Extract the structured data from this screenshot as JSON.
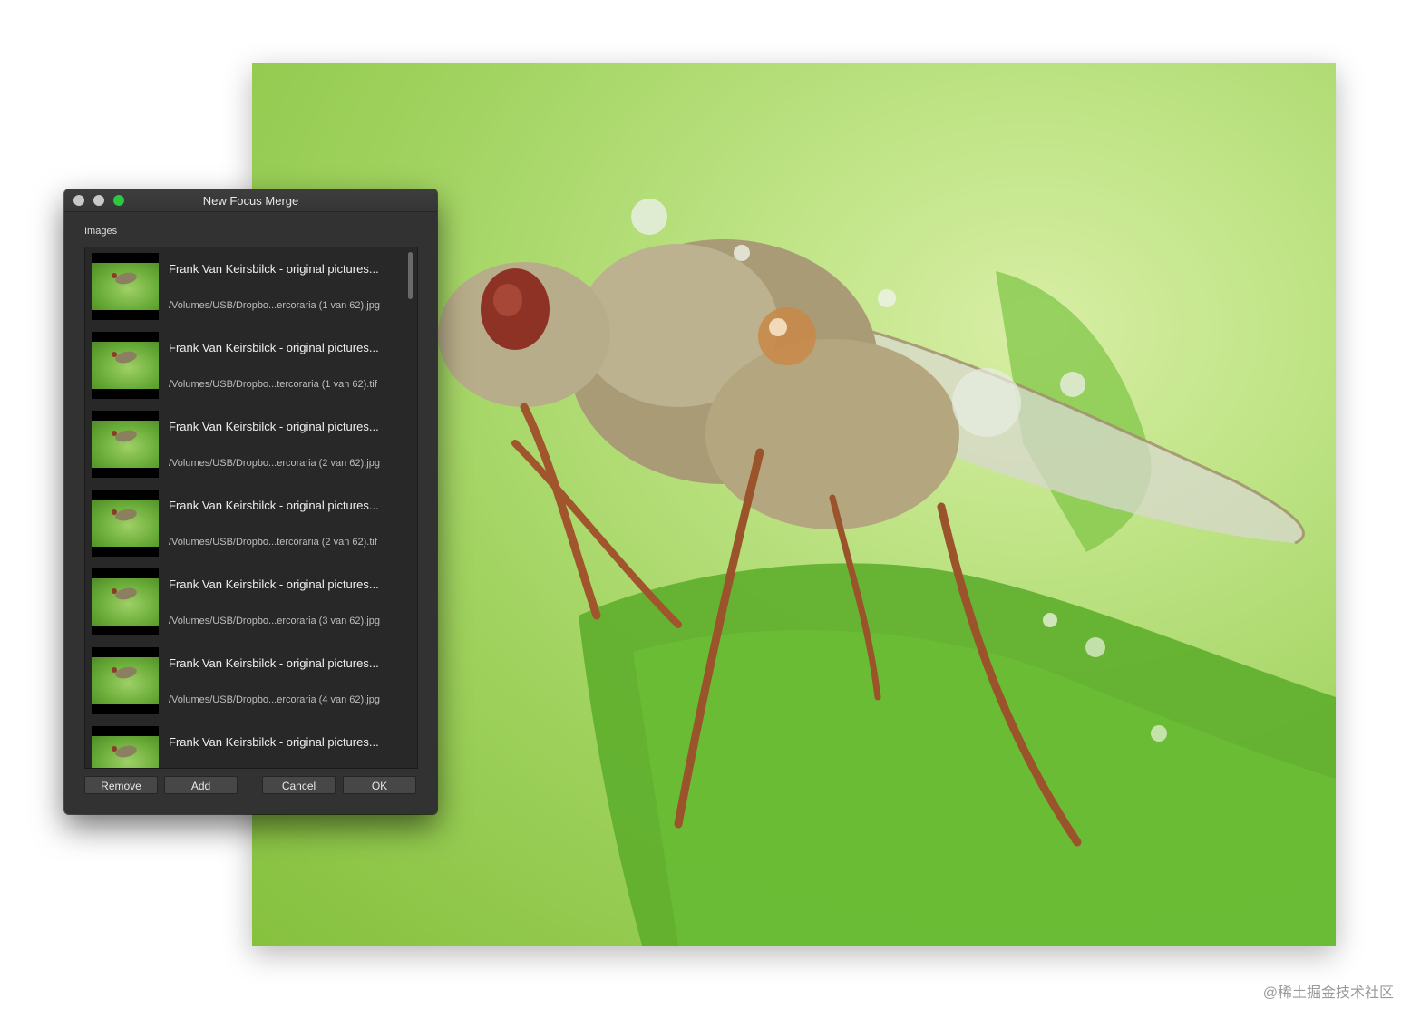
{
  "dialog": {
    "title": "New Focus Merge",
    "section_label": "Images",
    "items": [
      {
        "title": "Frank Van Keirsbilck -  original pictures...",
        "path": "/Volumes/USB/Dropbo...ercoraria (1 van 62).jpg"
      },
      {
        "title": "Frank Van Keirsbilck -  original pictures...",
        "path": "/Volumes/USB/Dropbo...tercoraria (1 van 62).tif"
      },
      {
        "title": "Frank Van Keirsbilck -  original pictures...",
        "path": "/Volumes/USB/Dropbo...ercoraria (2 van 62).jpg"
      },
      {
        "title": "Frank Van Keirsbilck -  original pictures...",
        "path": "/Volumes/USB/Dropbo...tercoraria (2 van 62).tif"
      },
      {
        "title": "Frank Van Keirsbilck -  original pictures...",
        "path": "/Volumes/USB/Dropbo...ercoraria (3 van 62).jpg"
      },
      {
        "title": "Frank Van Keirsbilck -  original pictures...",
        "path": "/Volumes/USB/Dropbo...ercoraria (4 van 62).jpg"
      },
      {
        "title": "Frank Van Keirsbilck -  original pictures...",
        "path": ""
      }
    ],
    "buttons": {
      "remove": "Remove",
      "add": "Add",
      "cancel": "Cancel",
      "ok": "OK"
    }
  },
  "footer_credit": "@稀土掘金技术社区",
  "colors": {
    "window_bg": "#323232",
    "list_bg": "#282828",
    "photo_green": "#9fd25e",
    "maximize_green": "#2ac940"
  }
}
